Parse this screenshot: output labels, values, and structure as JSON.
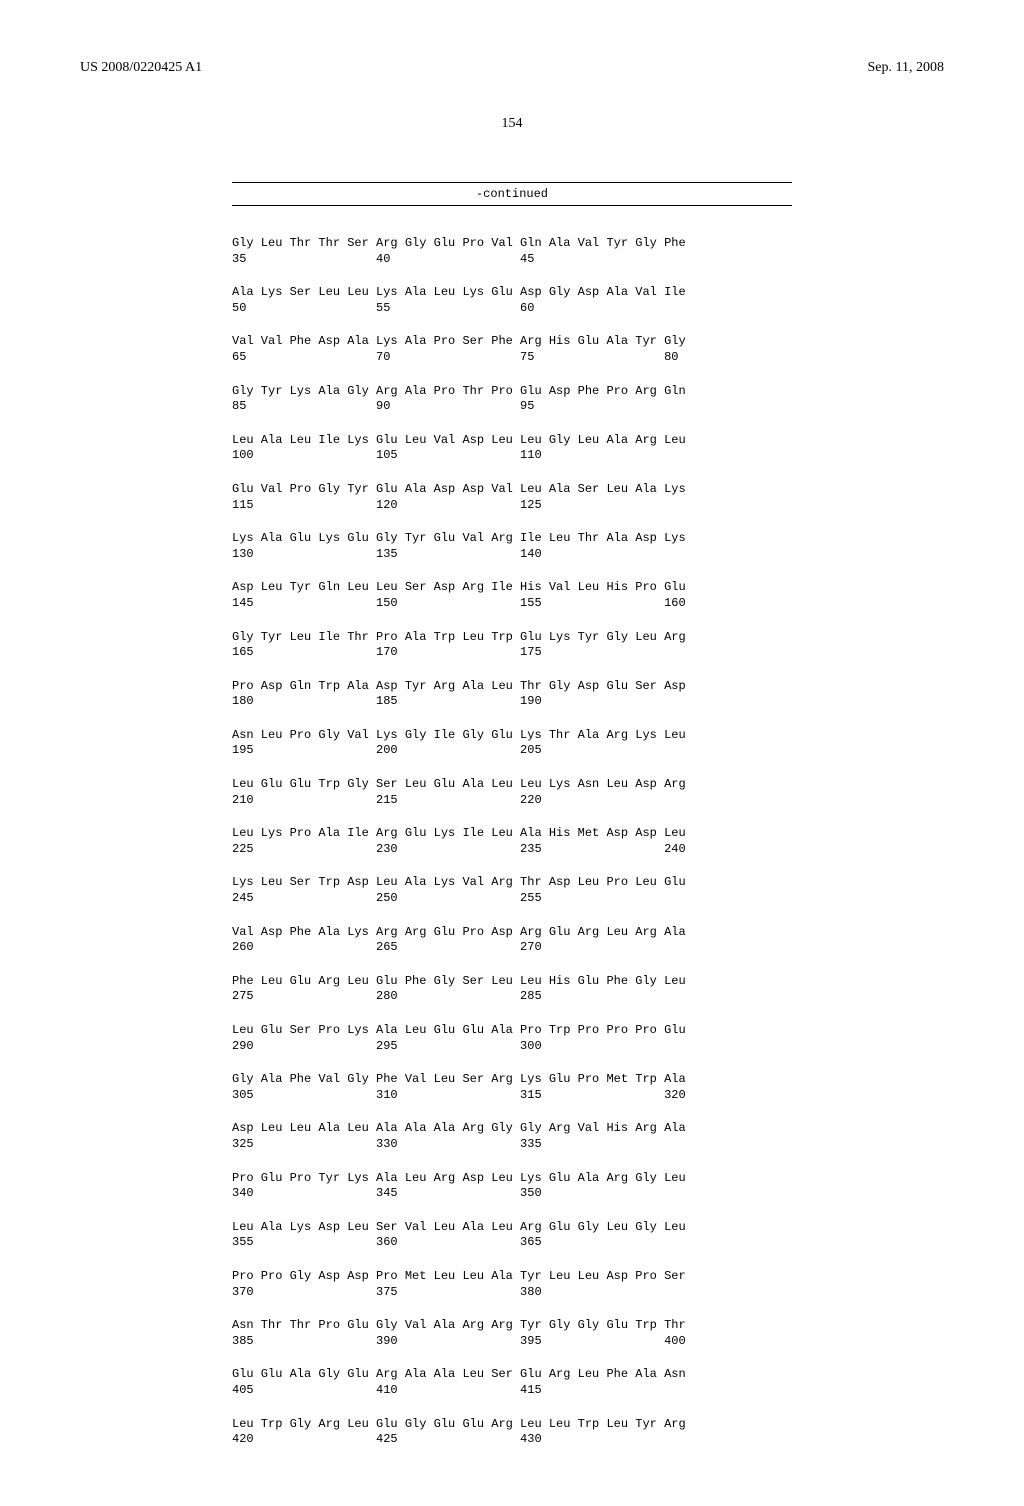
{
  "header": {
    "publication_number": "US 2008/0220425 A1",
    "publication_date": "Sep. 11, 2008"
  },
  "page_number": "154",
  "continued_label": "-continued",
  "sequence_rows": [
    {
      "aa": "Gly Leu Thr Thr Ser Arg Gly Glu Pro Val Gln Ala Val Tyr Gly Phe",
      "nums": "35                  40                  45"
    },
    {
      "aa": "Ala Lys Ser Leu Leu Lys Ala Leu Lys Glu Asp Gly Asp Ala Val Ile",
      "nums": "50                  55                  60"
    },
    {
      "aa": "Val Val Phe Asp Ala Lys Ala Pro Ser Phe Arg His Glu Ala Tyr Gly",
      "nums": "65                  70                  75                  80"
    },
    {
      "aa": "Gly Tyr Lys Ala Gly Arg Ala Pro Thr Pro Glu Asp Phe Pro Arg Gln",
      "nums": "85                  90                  95"
    },
    {
      "aa": "Leu Ala Leu Ile Lys Glu Leu Val Asp Leu Leu Gly Leu Ala Arg Leu",
      "nums": "100                 105                 110"
    },
    {
      "aa": "Glu Val Pro Gly Tyr Glu Ala Asp Asp Val Leu Ala Ser Leu Ala Lys",
      "nums": "115                 120                 125"
    },
    {
      "aa": "Lys Ala Glu Lys Glu Gly Tyr Glu Val Arg Ile Leu Thr Ala Asp Lys",
      "nums": "130                 135                 140"
    },
    {
      "aa": "Asp Leu Tyr Gln Leu Leu Ser Asp Arg Ile His Val Leu His Pro Glu",
      "nums": "145                 150                 155                 160"
    },
    {
      "aa": "Gly Tyr Leu Ile Thr Pro Ala Trp Leu Trp Glu Lys Tyr Gly Leu Arg",
      "nums": "165                 170                 175"
    },
    {
      "aa": "Pro Asp Gln Trp Ala Asp Tyr Arg Ala Leu Thr Gly Asp Glu Ser Asp",
      "nums": "180                 185                 190"
    },
    {
      "aa": "Asn Leu Pro Gly Val Lys Gly Ile Gly Glu Lys Thr Ala Arg Lys Leu",
      "nums": "195                 200                 205"
    },
    {
      "aa": "Leu Glu Glu Trp Gly Ser Leu Glu Ala Leu Leu Lys Asn Leu Asp Arg",
      "nums": "210                 215                 220"
    },
    {
      "aa": "Leu Lys Pro Ala Ile Arg Glu Lys Ile Leu Ala His Met Asp Asp Leu",
      "nums": "225                 230                 235                 240"
    },
    {
      "aa": "Lys Leu Ser Trp Asp Leu Ala Lys Val Arg Thr Asp Leu Pro Leu Glu",
      "nums": "245                 250                 255"
    },
    {
      "aa": "Val Asp Phe Ala Lys Arg Arg Glu Pro Asp Arg Glu Arg Leu Arg Ala",
      "nums": "260                 265                 270"
    },
    {
      "aa": "Phe Leu Glu Arg Leu Glu Phe Gly Ser Leu Leu His Glu Phe Gly Leu",
      "nums": "275                 280                 285"
    },
    {
      "aa": "Leu Glu Ser Pro Lys Ala Leu Glu Glu Ala Pro Trp Pro Pro Pro Glu",
      "nums": "290                 295                 300"
    },
    {
      "aa": "Gly Ala Phe Val Gly Phe Val Leu Ser Arg Lys Glu Pro Met Trp Ala",
      "nums": "305                 310                 315                 320"
    },
    {
      "aa": "Asp Leu Leu Ala Leu Ala Ala Ala Arg Gly Gly Arg Val His Arg Ala",
      "nums": "325                 330                 335"
    },
    {
      "aa": "Pro Glu Pro Tyr Lys Ala Leu Arg Asp Leu Lys Glu Ala Arg Gly Leu",
      "nums": "340                 345                 350"
    },
    {
      "aa": "Leu Ala Lys Asp Leu Ser Val Leu Ala Leu Arg Glu Gly Leu Gly Leu",
      "nums": "355                 360                 365"
    },
    {
      "aa": "Pro Pro Gly Asp Asp Pro Met Leu Leu Ala Tyr Leu Leu Asp Pro Ser",
      "nums": "370                 375                 380"
    },
    {
      "aa": "Asn Thr Thr Pro Glu Gly Val Ala Arg Arg Tyr Gly Gly Glu Trp Thr",
      "nums": "385                 390                 395                 400"
    },
    {
      "aa": "Glu Glu Ala Gly Glu Arg Ala Ala Leu Ser Glu Arg Leu Phe Ala Asn",
      "nums": "405                 410                 415"
    },
    {
      "aa": "Leu Trp Gly Arg Leu Glu Gly Glu Glu Arg Leu Leu Trp Leu Tyr Arg",
      "nums": "420                 425                 430"
    }
  ]
}
